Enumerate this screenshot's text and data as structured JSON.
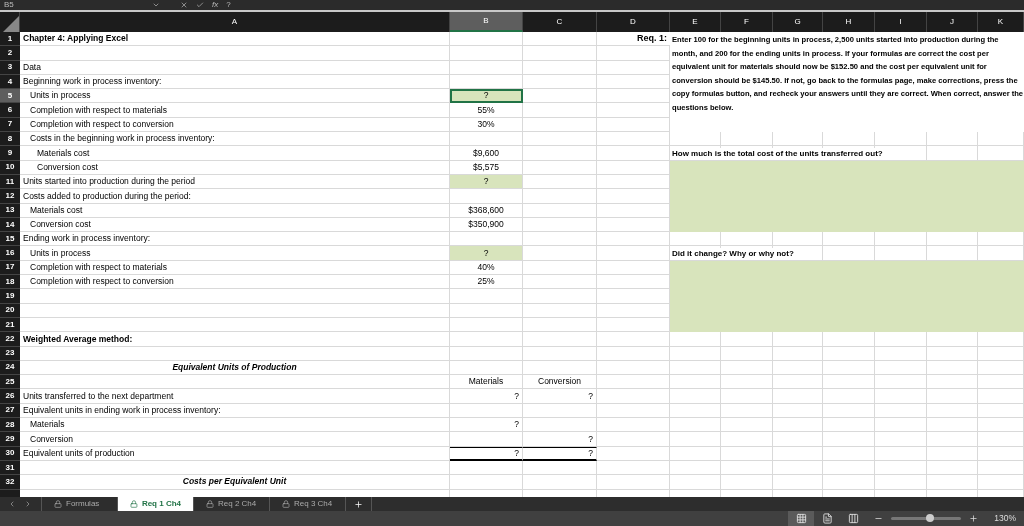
{
  "formula_bar": {
    "cell_ref": "B5",
    "function_label": "fx",
    "formula": "?"
  },
  "columns": [
    {
      "label": "A",
      "selected": false
    },
    {
      "label": "B",
      "selected": true
    },
    {
      "label": "C",
      "selected": false
    },
    {
      "label": "D",
      "selected": false
    },
    {
      "label": "E",
      "selected": false
    },
    {
      "label": "F",
      "selected": false
    },
    {
      "label": "G",
      "selected": false
    },
    {
      "label": "H",
      "selected": false
    },
    {
      "label": "I",
      "selected": false
    },
    {
      "label": "J",
      "selected": false
    },
    {
      "label": "K",
      "selected": false
    }
  ],
  "rows": [
    {
      "number": "1",
      "selected": false,
      "a": {
        "text": "Chapter 4: Applying Excel",
        "kind": "bold"
      }
    },
    {
      "number": "2",
      "selected": false
    },
    {
      "number": "3",
      "selected": false,
      "a": {
        "text": "Data",
        "kind": "plain"
      }
    },
    {
      "number": "4",
      "selected": false,
      "a": {
        "text": "Beginning work in process inventory:",
        "kind": "plain"
      }
    },
    {
      "number": "5",
      "selected": true,
      "a": {
        "text": "Units in process",
        "kind": "indent"
      },
      "b": {
        "text": "?",
        "kind": "input"
      }
    },
    {
      "number": "6",
      "selected": false,
      "a": {
        "text": "Completion with respect to materials",
        "kind": "indent"
      },
      "b": {
        "text": "55%",
        "kind": "value"
      }
    },
    {
      "number": "7",
      "selected": false,
      "a": {
        "text": "Completion with respect to conversion",
        "kind": "indent"
      },
      "b": {
        "text": "30%",
        "kind": "value"
      }
    },
    {
      "number": "8",
      "selected": false,
      "a": {
        "text": "Costs in the beginning work in process inventory:",
        "kind": "indent"
      }
    },
    {
      "number": "9",
      "selected": false,
      "a": {
        "text": "Materials cost",
        "kind": "indent2"
      },
      "b": {
        "text": "$9,600",
        "kind": "value"
      }
    },
    {
      "number": "10",
      "selected": false,
      "a": {
        "text": "Conversion cost",
        "kind": "indent2"
      },
      "b": {
        "text": "$5,575",
        "kind": "value"
      }
    },
    {
      "number": "11",
      "selected": false,
      "a": {
        "text": "Units started into production during the period",
        "kind": "plain"
      },
      "b": {
        "text": "?",
        "kind": "input"
      }
    },
    {
      "number": "12",
      "selected": false,
      "a": {
        "text": "Costs added to production during the period:",
        "kind": "plain"
      }
    },
    {
      "number": "13",
      "selected": false,
      "a": {
        "text": "Materials cost",
        "kind": "indent"
      },
      "b": {
        "text": "$368,600",
        "kind": "value"
      }
    },
    {
      "number": "14",
      "selected": false,
      "a": {
        "text": "Conversion cost",
        "kind": "indent"
      },
      "b": {
        "text": "$350,900",
        "kind": "value"
      }
    },
    {
      "number": "15",
      "selected": false,
      "a": {
        "text": "Ending work in process inventory:",
        "kind": "plain"
      }
    },
    {
      "number": "16",
      "selected": false,
      "a": {
        "text": "Units in process",
        "kind": "indent"
      },
      "b": {
        "text": "?",
        "kind": "input"
      }
    },
    {
      "number": "17",
      "selected": false,
      "a": {
        "text": "Completion with respect to materials",
        "kind": "indent"
      },
      "b": {
        "text": "40%",
        "kind": "value"
      }
    },
    {
      "number": "18",
      "selected": false,
      "a": {
        "text": "Completion with respect to conversion",
        "kind": "indent"
      },
      "b": {
        "text": "25%",
        "kind": "value"
      }
    },
    {
      "number": "19",
      "selected": false
    },
    {
      "number": "20",
      "selected": false
    },
    {
      "number": "21",
      "selected": false
    },
    {
      "number": "22",
      "selected": false,
      "a": {
        "text": "Weighted Average method:",
        "kind": "bold"
      }
    },
    {
      "number": "23",
      "selected": false
    },
    {
      "number": "24",
      "selected": false,
      "a": {
        "text": "Equivalent Units of Production",
        "kind": "title"
      }
    },
    {
      "number": "25",
      "selected": false,
      "b": {
        "text": "Materials",
        "kind": "header"
      },
      "c": {
        "text": "Conversion",
        "kind": "header"
      }
    },
    {
      "number": "26",
      "selected": false,
      "a": {
        "text": "Units transferred to the next department",
        "kind": "plain"
      },
      "b": {
        "text": "?",
        "kind": "result"
      },
      "c": {
        "text": "?",
        "kind": "result"
      }
    },
    {
      "number": "27",
      "selected": false,
      "a": {
        "text": "Equivalent units in ending work in process inventory:",
        "kind": "plain"
      }
    },
    {
      "number": "28",
      "selected": false,
      "a": {
        "text": "Materials",
        "kind": "indent"
      },
      "b": {
        "text": "?",
        "kind": "result"
      }
    },
    {
      "number": "29",
      "selected": false,
      "a": {
        "text": "Conversion",
        "kind": "indent"
      },
      "c": {
        "text": "?",
        "kind": "result"
      }
    },
    {
      "number": "30",
      "selected": false,
      "a": {
        "text": "Equivalent units of production",
        "kind": "plain"
      },
      "b": {
        "text": "?",
        "kind": "total"
      },
      "c": {
        "text": "?",
        "kind": "total"
      }
    },
    {
      "number": "31",
      "selected": false
    },
    {
      "number": "32",
      "selected": false,
      "a": {
        "text": "Costs per Equivalent Unit",
        "kind": "title"
      }
    }
  ],
  "requirement": {
    "label": "Req. 1:",
    "text": "Enter 100 for the beginning units in process, 2,500 units started into production during the month, and 200 for the ending units in process.  If your formulas are correct the cost per equivalent unit for materials should now be $152.50 and the cost per equivalent unit for conversion should be $145.50.  If not, go back to the formulas page, make corrections, press the copy formulas button, and recheck your answers until they are correct.  When correct, answer the questions below."
  },
  "questions": [
    {
      "text": "How much is the total cost of the units transferred out?"
    },
    {
      "text": "Did it change?  Why or why not?"
    }
  ],
  "sheet_tabs": [
    {
      "label": "Formulas",
      "selected": false,
      "locked": true
    },
    {
      "label": "Req 1 Ch4",
      "selected": true,
      "locked": true
    },
    {
      "label": "Req 2 Ch4",
      "selected": false,
      "locked": true
    },
    {
      "label": "Req 3 Ch4",
      "selected": false,
      "locked": true
    }
  ],
  "status_bar": {
    "views": [
      {
        "kind": "normal",
        "selected": true
      },
      {
        "kind": "page_layout",
        "selected": false
      },
      {
        "kind": "page_break",
        "selected": false
      }
    ],
    "zoom": {
      "level": 0.55,
      "reading": "130%"
    }
  }
}
